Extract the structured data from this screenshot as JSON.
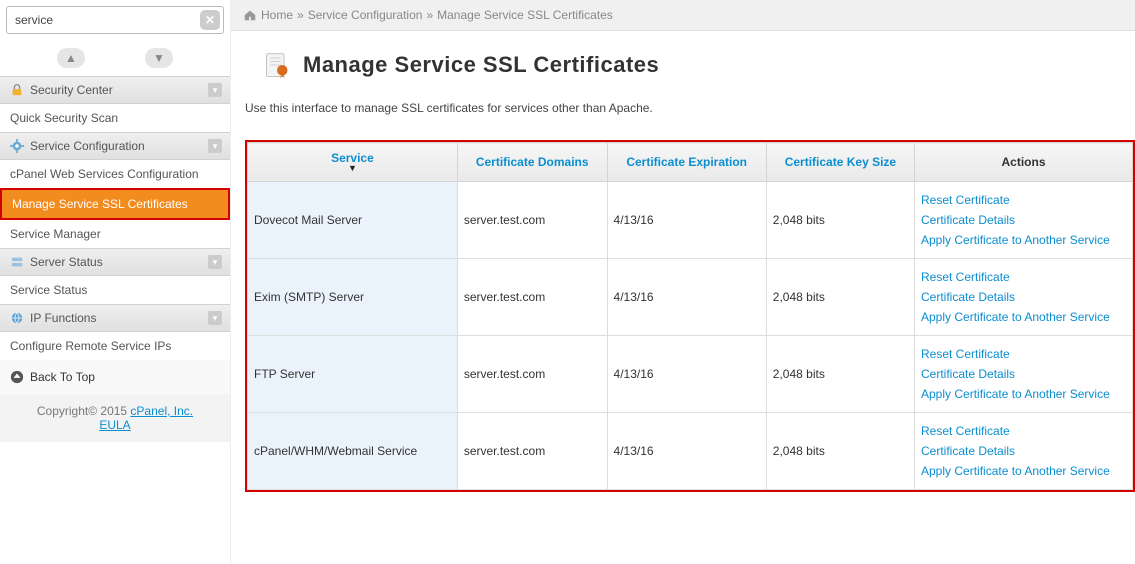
{
  "search": {
    "value": "service"
  },
  "breadcrumb": {
    "home": "Home",
    "sep": "»",
    "level1": "Service Configuration",
    "level2": "Manage Service SSL Certificates"
  },
  "page": {
    "title": "Manage Service SSL Certificates",
    "description": "Use this interface to manage SSL certificates for services other than Apache."
  },
  "sidebar": {
    "security_center": "Security Center",
    "quick_security_scan": "Quick Security Scan",
    "service_configuration": "Service Configuration",
    "cpanel_web_services": "cPanel Web Services Configuration",
    "manage_ssl": "Manage Service SSL Certificates",
    "service_manager": "Service Manager",
    "server_status": "Server Status",
    "service_status": "Service Status",
    "ip_functions": "IP Functions",
    "configure_remote_ips": "Configure Remote Service IPs",
    "back_to_top": "Back To Top",
    "copyright_pre": "Copyright© 2015 ",
    "copyright_link": "cPanel, Inc.",
    "eula": "EULA"
  },
  "table": {
    "headers": {
      "service": "Service",
      "domains": "Certificate Domains",
      "expiration": "Certificate Expiration",
      "key_size": "Certificate Key Size",
      "actions": "Actions"
    },
    "action_labels": {
      "reset": "Reset Certificate",
      "details": "Certificate Details",
      "apply": "Apply Certificate to Another Service"
    },
    "rows": [
      {
        "service": "Dovecot Mail Server",
        "domain": "server.test.com",
        "exp": "4/13/16",
        "key": "2,048 bits"
      },
      {
        "service": "Exim (SMTP) Server",
        "domain": "server.test.com",
        "exp": "4/13/16",
        "key": "2,048 bits"
      },
      {
        "service": "FTP Server",
        "domain": "server.test.com",
        "exp": "4/13/16",
        "key": "2,048 bits"
      },
      {
        "service": "cPanel/WHM/Webmail Service",
        "domain": "server.test.com",
        "exp": "4/13/16",
        "key": "2,048 bits"
      }
    ]
  }
}
